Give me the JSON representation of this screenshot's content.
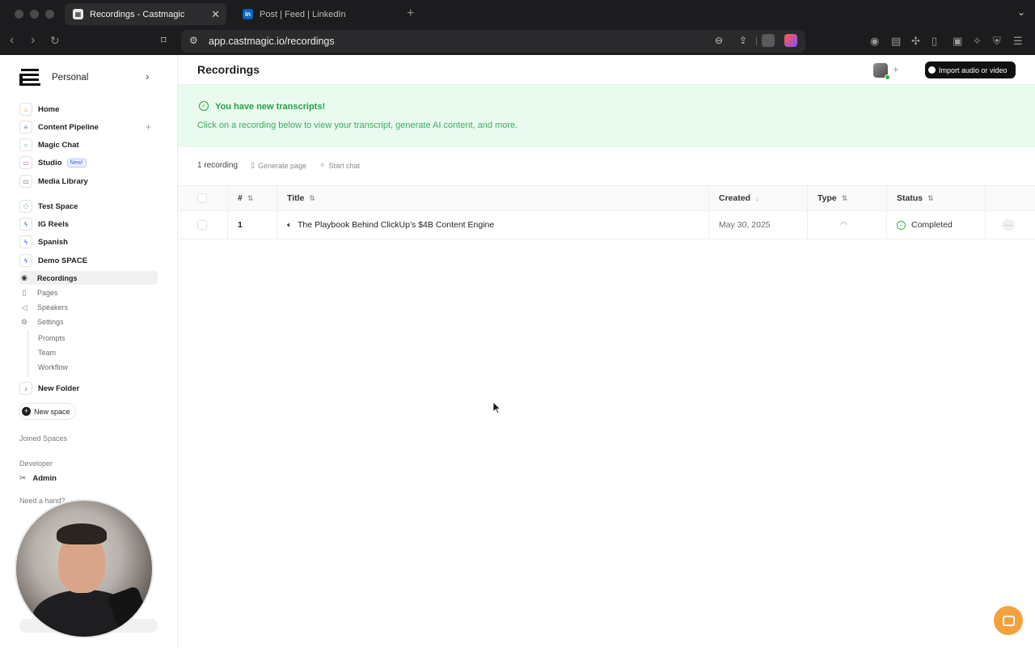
{
  "browser": {
    "tabs": [
      {
        "title": "Recordings - Castmagic",
        "active": true
      },
      {
        "title": "Post | Feed | LinkedIn",
        "active": false
      }
    ],
    "linkedin_favicon": "in",
    "url": "app.castmagic.io/recordings"
  },
  "sidebar": {
    "workspace": "Personal",
    "items": [
      {
        "label": "Home",
        "icon": "home-icon"
      },
      {
        "label": "Content Pipeline",
        "icon": "layers-icon"
      },
      {
        "label": "Magic Chat",
        "icon": "chat-icon"
      },
      {
        "label": "Studio",
        "icon": "studio-icon",
        "badge": "New!"
      },
      {
        "label": "Media Library",
        "icon": "folder-icon"
      }
    ],
    "spaces": [
      {
        "label": "Test Space"
      },
      {
        "label": "IG Reels"
      },
      {
        "label": "Spanish"
      },
      {
        "label": "Demo SPACE"
      }
    ],
    "space_items": [
      {
        "label": "Recordings",
        "active": true
      },
      {
        "label": "Pages"
      },
      {
        "label": "Speakers"
      },
      {
        "label": "Settings"
      }
    ],
    "settings_children": [
      "Prompts",
      "Team",
      "Workflow"
    ],
    "new_folder": "New Folder",
    "new_space": "New space",
    "joined_spaces": "Joined Spaces",
    "developer": "Developer",
    "admin": "Admin",
    "need_a_hand": "Need a hand?"
  },
  "main": {
    "title": "Recordings",
    "import_button": "Import audio or video",
    "banner": {
      "title": "You have new transcripts!",
      "subtitle": "Click on a recording below to view your transcript, generate AI content, and more."
    },
    "count": "1 recording",
    "actions": [
      "Generate page",
      "Start chat"
    ],
    "table": {
      "headers": [
        "#",
        "Title",
        "Created",
        "Type",
        "Status"
      ],
      "rows": [
        {
          "num": "1",
          "title": "The Playbook Behind ClickUp’s $4B Content Engine",
          "created": "May 30, 2025",
          "status": "Completed"
        }
      ]
    }
  },
  "colors": {
    "accent_green": "#27a046",
    "banner_bg": "#e9fbef",
    "intercom": "#f3a23b"
  }
}
